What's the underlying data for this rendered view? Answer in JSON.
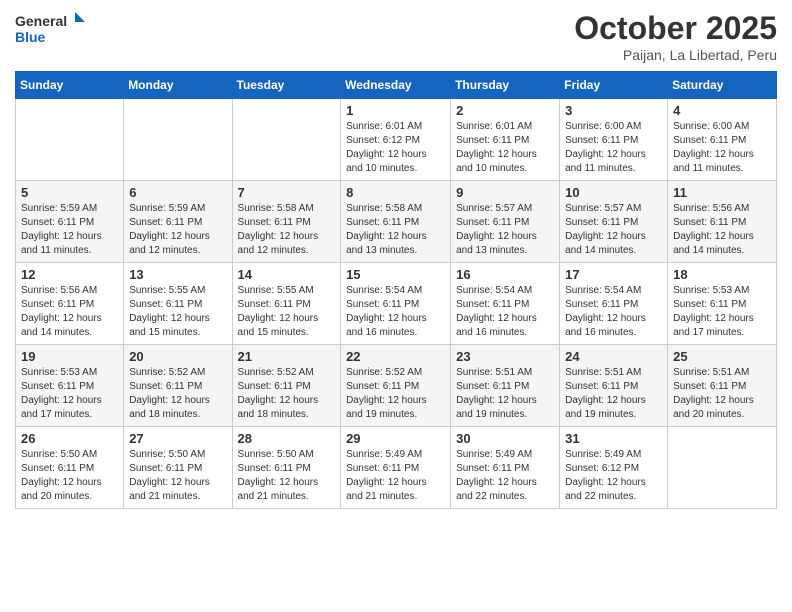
{
  "header": {
    "logo_general": "General",
    "logo_blue": "Blue",
    "month": "October 2025",
    "location": "Paijan, La Libertad, Peru"
  },
  "weekdays": [
    "Sunday",
    "Monday",
    "Tuesday",
    "Wednesday",
    "Thursday",
    "Friday",
    "Saturday"
  ],
  "weeks": [
    [
      {
        "num": "",
        "info": ""
      },
      {
        "num": "",
        "info": ""
      },
      {
        "num": "",
        "info": ""
      },
      {
        "num": "1",
        "info": "Sunrise: 6:01 AM\nSunset: 6:12 PM\nDaylight: 12 hours and 10 minutes."
      },
      {
        "num": "2",
        "info": "Sunrise: 6:01 AM\nSunset: 6:11 PM\nDaylight: 12 hours and 10 minutes."
      },
      {
        "num": "3",
        "info": "Sunrise: 6:00 AM\nSunset: 6:11 PM\nDaylight: 12 hours and 11 minutes."
      },
      {
        "num": "4",
        "info": "Sunrise: 6:00 AM\nSunset: 6:11 PM\nDaylight: 12 hours and 11 minutes."
      }
    ],
    [
      {
        "num": "5",
        "info": "Sunrise: 5:59 AM\nSunset: 6:11 PM\nDaylight: 12 hours and 11 minutes."
      },
      {
        "num": "6",
        "info": "Sunrise: 5:59 AM\nSunset: 6:11 PM\nDaylight: 12 hours and 12 minutes."
      },
      {
        "num": "7",
        "info": "Sunrise: 5:58 AM\nSunset: 6:11 PM\nDaylight: 12 hours and 12 minutes."
      },
      {
        "num": "8",
        "info": "Sunrise: 5:58 AM\nSunset: 6:11 PM\nDaylight: 12 hours and 13 minutes."
      },
      {
        "num": "9",
        "info": "Sunrise: 5:57 AM\nSunset: 6:11 PM\nDaylight: 12 hours and 13 minutes."
      },
      {
        "num": "10",
        "info": "Sunrise: 5:57 AM\nSunset: 6:11 PM\nDaylight: 12 hours and 14 minutes."
      },
      {
        "num": "11",
        "info": "Sunrise: 5:56 AM\nSunset: 6:11 PM\nDaylight: 12 hours and 14 minutes."
      }
    ],
    [
      {
        "num": "12",
        "info": "Sunrise: 5:56 AM\nSunset: 6:11 PM\nDaylight: 12 hours and 14 minutes."
      },
      {
        "num": "13",
        "info": "Sunrise: 5:55 AM\nSunset: 6:11 PM\nDaylight: 12 hours and 15 minutes."
      },
      {
        "num": "14",
        "info": "Sunrise: 5:55 AM\nSunset: 6:11 PM\nDaylight: 12 hours and 15 minutes."
      },
      {
        "num": "15",
        "info": "Sunrise: 5:54 AM\nSunset: 6:11 PM\nDaylight: 12 hours and 16 minutes."
      },
      {
        "num": "16",
        "info": "Sunrise: 5:54 AM\nSunset: 6:11 PM\nDaylight: 12 hours and 16 minutes."
      },
      {
        "num": "17",
        "info": "Sunrise: 5:54 AM\nSunset: 6:11 PM\nDaylight: 12 hours and 16 minutes."
      },
      {
        "num": "18",
        "info": "Sunrise: 5:53 AM\nSunset: 6:11 PM\nDaylight: 12 hours and 17 minutes."
      }
    ],
    [
      {
        "num": "19",
        "info": "Sunrise: 5:53 AM\nSunset: 6:11 PM\nDaylight: 12 hours and 17 minutes."
      },
      {
        "num": "20",
        "info": "Sunrise: 5:52 AM\nSunset: 6:11 PM\nDaylight: 12 hours and 18 minutes."
      },
      {
        "num": "21",
        "info": "Sunrise: 5:52 AM\nSunset: 6:11 PM\nDaylight: 12 hours and 18 minutes."
      },
      {
        "num": "22",
        "info": "Sunrise: 5:52 AM\nSunset: 6:11 PM\nDaylight: 12 hours and 19 minutes."
      },
      {
        "num": "23",
        "info": "Sunrise: 5:51 AM\nSunset: 6:11 PM\nDaylight: 12 hours and 19 minutes."
      },
      {
        "num": "24",
        "info": "Sunrise: 5:51 AM\nSunset: 6:11 PM\nDaylight: 12 hours and 19 minutes."
      },
      {
        "num": "25",
        "info": "Sunrise: 5:51 AM\nSunset: 6:11 PM\nDaylight: 12 hours and 20 minutes."
      }
    ],
    [
      {
        "num": "26",
        "info": "Sunrise: 5:50 AM\nSunset: 6:11 PM\nDaylight: 12 hours and 20 minutes."
      },
      {
        "num": "27",
        "info": "Sunrise: 5:50 AM\nSunset: 6:11 PM\nDaylight: 12 hours and 21 minutes."
      },
      {
        "num": "28",
        "info": "Sunrise: 5:50 AM\nSunset: 6:11 PM\nDaylight: 12 hours and 21 minutes."
      },
      {
        "num": "29",
        "info": "Sunrise: 5:49 AM\nSunset: 6:11 PM\nDaylight: 12 hours and 21 minutes."
      },
      {
        "num": "30",
        "info": "Sunrise: 5:49 AM\nSunset: 6:11 PM\nDaylight: 12 hours and 22 minutes."
      },
      {
        "num": "31",
        "info": "Sunrise: 5:49 AM\nSunset: 6:12 PM\nDaylight: 12 hours and 22 minutes."
      },
      {
        "num": "",
        "info": ""
      }
    ]
  ]
}
